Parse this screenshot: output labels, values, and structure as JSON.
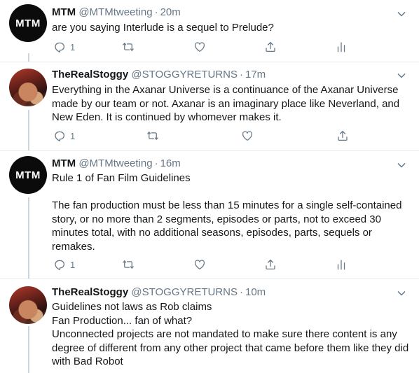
{
  "tweets": [
    {
      "name": "MTM",
      "handle": "@MTMtweeting",
      "time": "20m",
      "avatar_text": "MTM",
      "avatar_icon": "mtm-logo-avatar",
      "paragraphs": [
        "are you saying Interlude is a sequel to Prelude?"
      ],
      "reply_count": "1"
    },
    {
      "name": "TheRealStoggy",
      "handle": "@STOGGYRETURNS",
      "time": "17m",
      "avatar_icon": "profile-photo-avatar",
      "paragraphs": [
        "Everything in the Axanar Universe is a continuance of the Axanar Universe made by our team or not. Axanar is an imaginary place like Neverland, and New Eden. It is continued by whomever makes it."
      ],
      "reply_count": "1"
    },
    {
      "name": "MTM",
      "handle": "@MTMtweeting",
      "time": "16m",
      "avatar_text": "MTM",
      "avatar_icon": "mtm-logo-avatar",
      "paragraphs": [
        "Rule 1 of Fan Film Guidelines",
        "The fan production must be less than 15 minutes for a single self-contained story, or no more than 2 segments, episodes or parts, not to exceed 30 minutes total, with no additional seasons, episodes, parts, sequels or remakes."
      ],
      "reply_count": "1"
    },
    {
      "name": "TheRealStoggy",
      "handle": "@STOGGYRETURNS",
      "time": "10m",
      "avatar_icon": "profile-photo-avatar",
      "paragraphs": [
        "Guidelines not laws as Rob claims",
        "Fan Production... fan of what?",
        "Unconnected projects are not mandated to make sure there content is any degree of different from any other project that came before them like they did with Bad Robot"
      ]
    }
  ],
  "separator": "·",
  "colors": {
    "text": "#14171a",
    "secondary": "#657786",
    "border": "#e6ecf0",
    "thread": "#ccd6dd"
  },
  "icons": [
    "reply-icon",
    "retweet-icon",
    "like-icon",
    "share-icon",
    "analytics-icon",
    "chevron-down-icon"
  ]
}
